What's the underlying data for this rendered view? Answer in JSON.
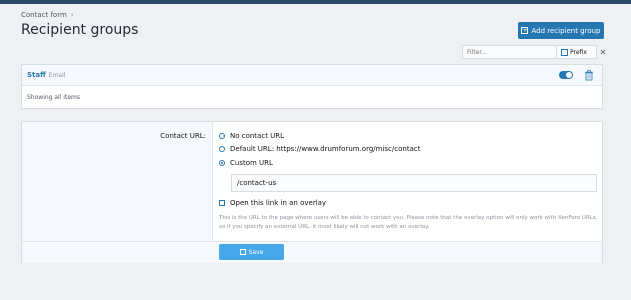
{
  "breadcrumb": {
    "item": "Contact form"
  },
  "page_title": "Recipient groups",
  "add_button": {
    "label": "Add recipient group"
  },
  "filter": {
    "placeholder": "Filter...",
    "prefix_label": "Prefix",
    "close": "✕"
  },
  "list": {
    "rows": [
      {
        "name": "Staff",
        "hint": "Email",
        "enabled": true
      }
    ],
    "footer": "Showing all items"
  },
  "form": {
    "label": "Contact URL:",
    "options": {
      "none": "No contact URL",
      "default": "Default URL: https://www.drumforum.org/misc/contact",
      "custom": "Custom URL"
    },
    "selected": "custom",
    "custom_value": "/contact-us",
    "overlay_label": "Open this link in an overlay",
    "help": "This is the URL to the page where users will be able to contact you. Please note that the overlay option will only work with XenForo URLs, so if you specify an external URL, it most likely will not work with an overlay.",
    "save_label": "Save"
  },
  "colors": {
    "accent": "#2577b1",
    "save": "#47a7eb",
    "topbar": "#2b4a6e"
  }
}
